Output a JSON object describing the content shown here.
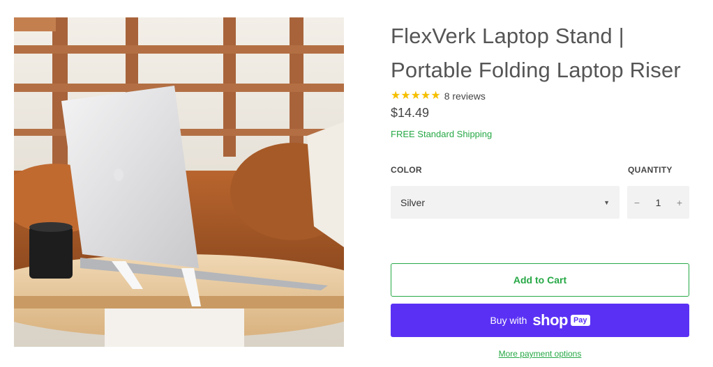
{
  "product": {
    "title": "FlexVerk Laptop Stand | Portable Folding Laptop Riser",
    "stars": "★★★★★",
    "reviews": "8 reviews",
    "price": "$14.49",
    "shipping": "FREE Standard Shipping"
  },
  "options": {
    "color_label": "COLOR",
    "color_value": "Silver",
    "quantity_label": "QUANTITY",
    "quantity_value": "1",
    "minus": "−",
    "plus": "+",
    "caret": "▼"
  },
  "actions": {
    "add_to_cart": "Add to Cart",
    "buy_with": "Buy with",
    "shop_word": "shop",
    "pay_badge": "Pay",
    "more_payment": "More payment options"
  },
  "colors": {
    "accent_green": "#26a845",
    "shop_purple": "#5a31f4",
    "star_yellow": "#f5bf00"
  }
}
